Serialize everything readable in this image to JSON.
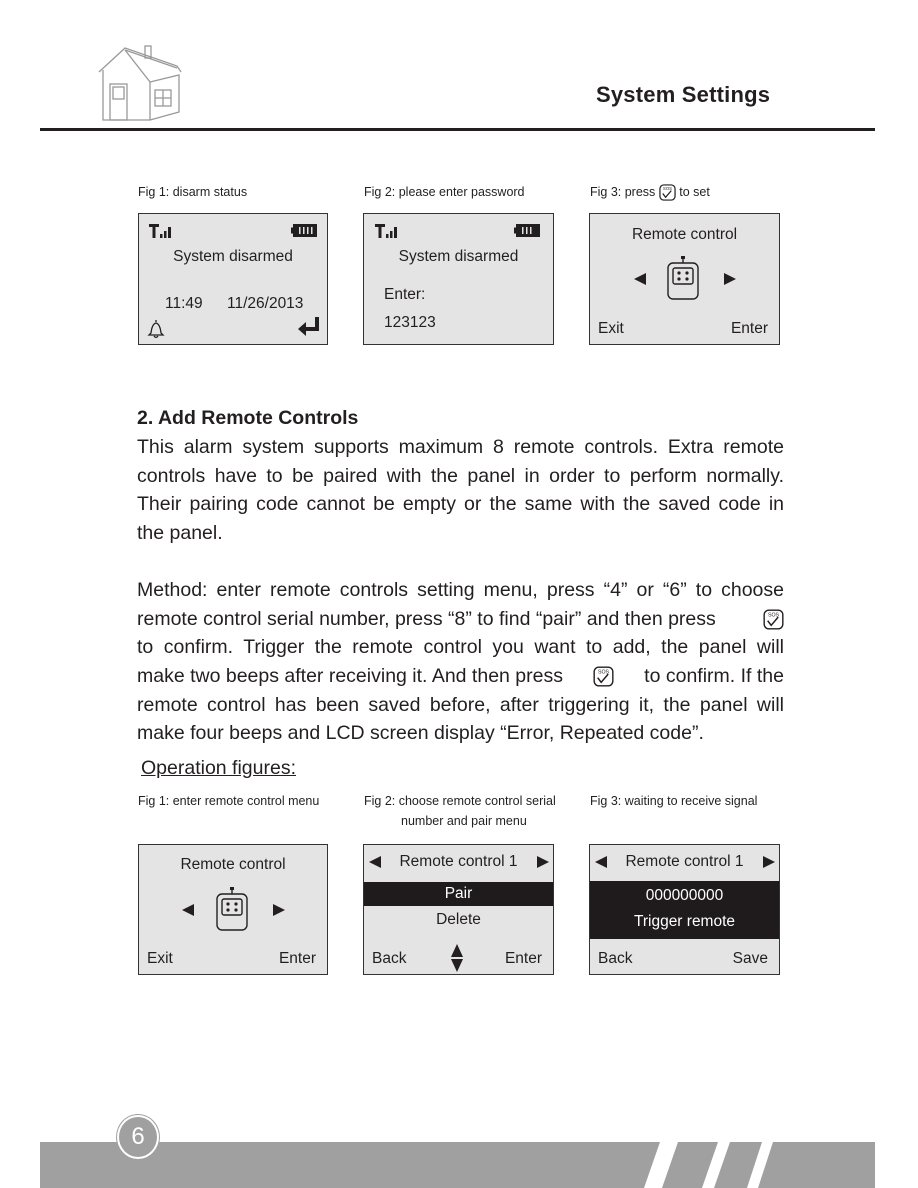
{
  "header": {
    "title": "System Settings",
    "logo_icon": "house-icon"
  },
  "top_figures": [
    {
      "caption": "Fig 1: disarm status",
      "icons": [
        "signal-icon",
        "battery-icon",
        "bell-icon",
        "enter-arrow-icon"
      ],
      "status": "System  disarmed",
      "time": "11:49",
      "date": "11/26/2013"
    },
    {
      "caption": "Fig 2: please enter password",
      "icons": [
        "signal-icon",
        "battery-icon"
      ],
      "status": "System  disarmed",
      "prompt": "Enter:",
      "value": "123123"
    },
    {
      "caption_pre": "Fig 3: press",
      "caption_icon": "sos-confirm-key-icon",
      "caption_post": "to set",
      "title": "Remote control",
      "left": "Exit",
      "right": "Enter",
      "icons": [
        "left-arrow-icon",
        "remote-control-icon",
        "right-arrow-icon"
      ]
    }
  ],
  "section": {
    "heading": "2.  Add Remote Controls",
    "paragraph1": [
      "This alarm system supports maximum 8 remote controls. Extra remote",
      "controls have to be paired with the panel in order to perform normally.",
      "Their pairing code cannot be empty or the same with the saved code in",
      "the panel."
    ],
    "paragraph2": {
      "line1": "Method: enter remote controls setting menu, press “4” or “6” to choose",
      "line2": "remote control serial number, press “8” to find “pair” and then press",
      "line3": "to confirm. Trigger the remote control you want to add, the panel will",
      "line4a": "make two beeps after receiving it. And then press",
      "line4b": "to confirm. If the",
      "line5": "remote control has been saved before, after triggering it, the panel will",
      "line6": "make four beeps and LCD screen display “Error, Repeated code”."
    },
    "operation_label": "Operation figures:"
  },
  "bottom_figures": [
    {
      "caption": "Fig 1: enter remote control menu",
      "title": "Remote control",
      "left": "Exit",
      "right": "Enter"
    },
    {
      "caption_line1": "Fig 2: choose remote control serial",
      "caption_line2": "number and pair menu",
      "title": "Remote control  1",
      "selected": "Pair",
      "option": "Delete",
      "left": "Back",
      "right": "Enter"
    },
    {
      "caption": "Fig 3: waiting to receive signal",
      "title": "Remote control  1",
      "code": "000000000",
      "message": "Trigger  remote",
      "left": "Back",
      "right": "Save"
    }
  ],
  "footer": {
    "page_number": "6"
  }
}
